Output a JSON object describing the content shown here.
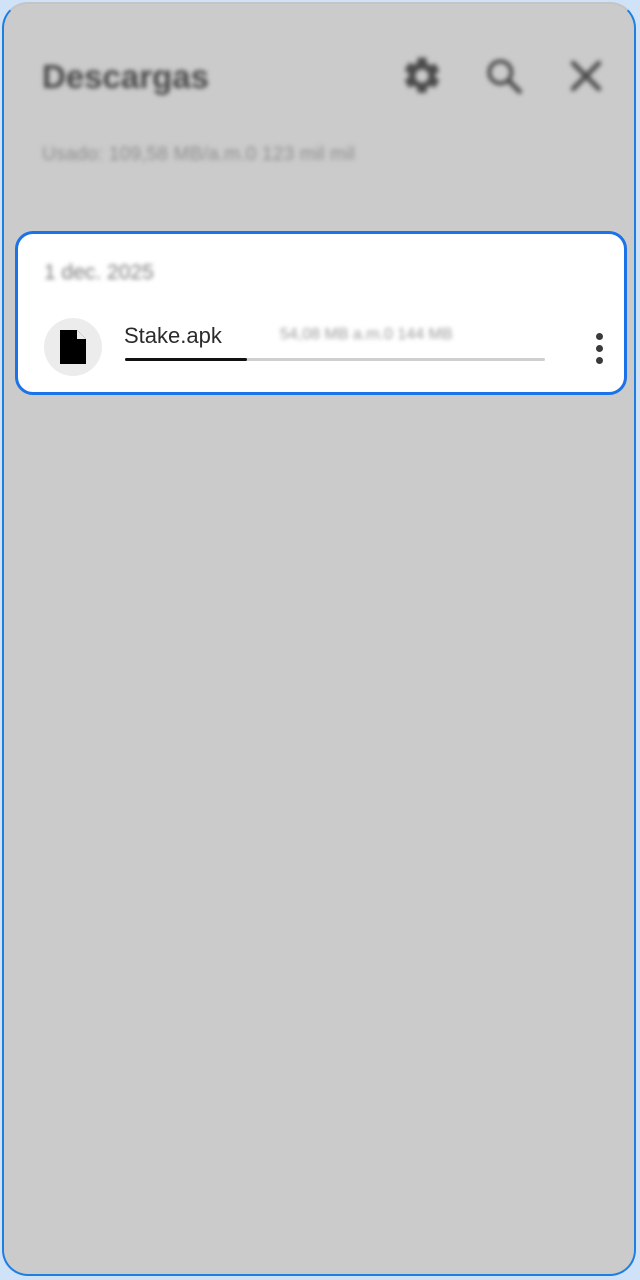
{
  "header": {
    "title": "Descargas",
    "settings_icon": "gear-icon",
    "search_icon": "search-icon",
    "close_icon": "close-icon",
    "storage_info": "Usado: 109,58 MB/a.m.0 123 mil mil"
  },
  "downloads": {
    "date_label": "1 dec. 2025",
    "items": [
      {
        "name": "Stake.apk",
        "status": "54,08 MB a.m.0 144 MB",
        "progress": 0.29,
        "icon": "file-icon",
        "menu_icon": "more-vert-icon"
      }
    ]
  },
  "colors": {
    "accent": "#1a73e8",
    "panel_background": "#cbcbcb",
    "card_background": "#ffffff",
    "progress_fill": "#111111"
  }
}
